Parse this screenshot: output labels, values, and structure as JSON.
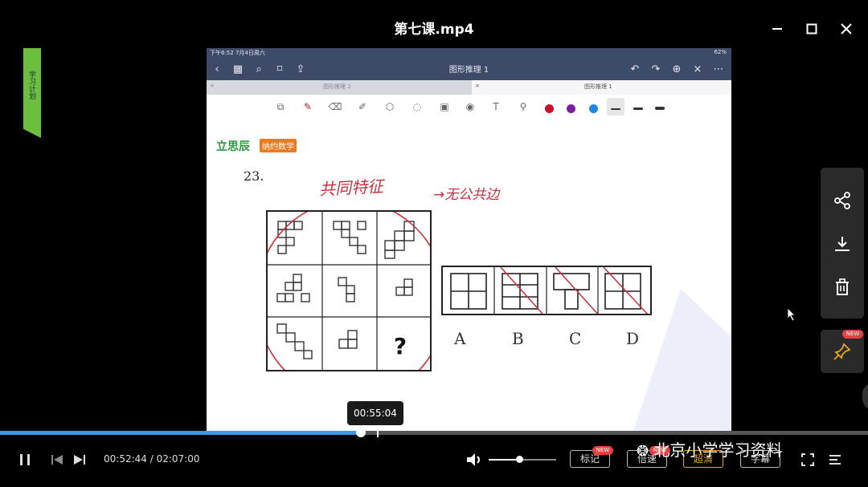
{
  "window": {
    "title": "第七课.mp4"
  },
  "left_tab": {
    "label": "学习计划"
  },
  "video": {
    "status_time": "下午6:52  7月4日周六",
    "status_right": "62%",
    "doc_title": "图形推理 1",
    "tab_inactive": "图形推理 2",
    "tab_active": "图形推理 1",
    "brand": "立思辰",
    "brand_tag": "纳约数学",
    "question_number": "23.",
    "handwritten_note_1": "共同特征",
    "handwritten_note_2": "→无公共边",
    "question_mark": "?",
    "options": [
      "A",
      "B",
      "C",
      "D"
    ],
    "pen_colors": [
      "#c8102e",
      "#7b1fa2",
      "#1e88e5"
    ]
  },
  "player": {
    "hover_time": "00:55:04",
    "current_time": "00:52:44",
    "separator": "/",
    "total_time": "02:07:00",
    "progress_fraction": 0.416,
    "hover_fraction": 0.434,
    "volume_fraction": 0.45,
    "chips": [
      "标记",
      "倍速",
      "超清",
      "字幕"
    ],
    "new_badge": "NEW",
    "watermark": "北京小学学习资料"
  },
  "colors": {
    "accent": "#3d9ae8",
    "brand_green": "#2e9a44",
    "ink_red": "#c8303c"
  }
}
